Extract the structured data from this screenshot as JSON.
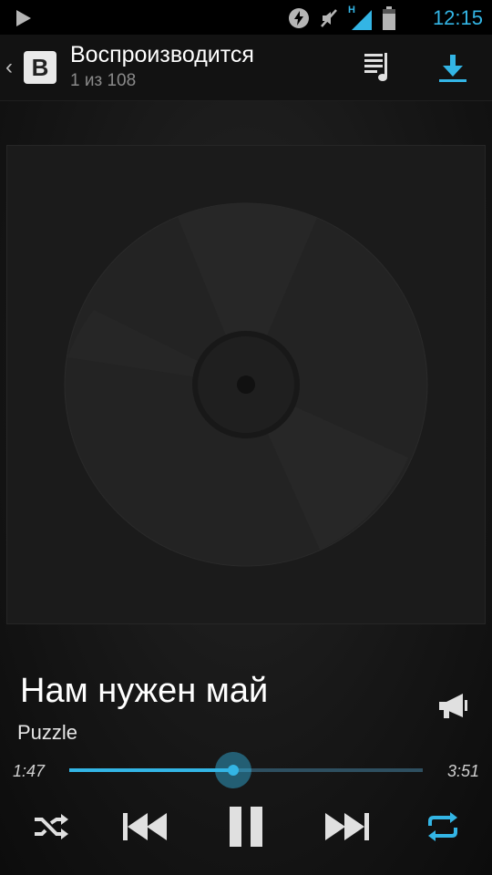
{
  "status_bar": {
    "time": "12:15",
    "network_label": "H",
    "icons": [
      "play-indicator-icon",
      "bolt-icon",
      "mute-icon",
      "signal-icon",
      "battery-icon"
    ]
  },
  "action_bar": {
    "back_glyph": "‹",
    "logo_letter": "B",
    "title": "Воспроизводится",
    "subtitle": "1 из 108"
  },
  "track": {
    "title": "Нам нужен май",
    "artist": "Puzzle"
  },
  "playback": {
    "elapsed": "1:47",
    "duration": "3:51",
    "progress_fraction": 0.463
  },
  "colors": {
    "accent": "#33b5e5",
    "icon": "#e0e0e0"
  }
}
